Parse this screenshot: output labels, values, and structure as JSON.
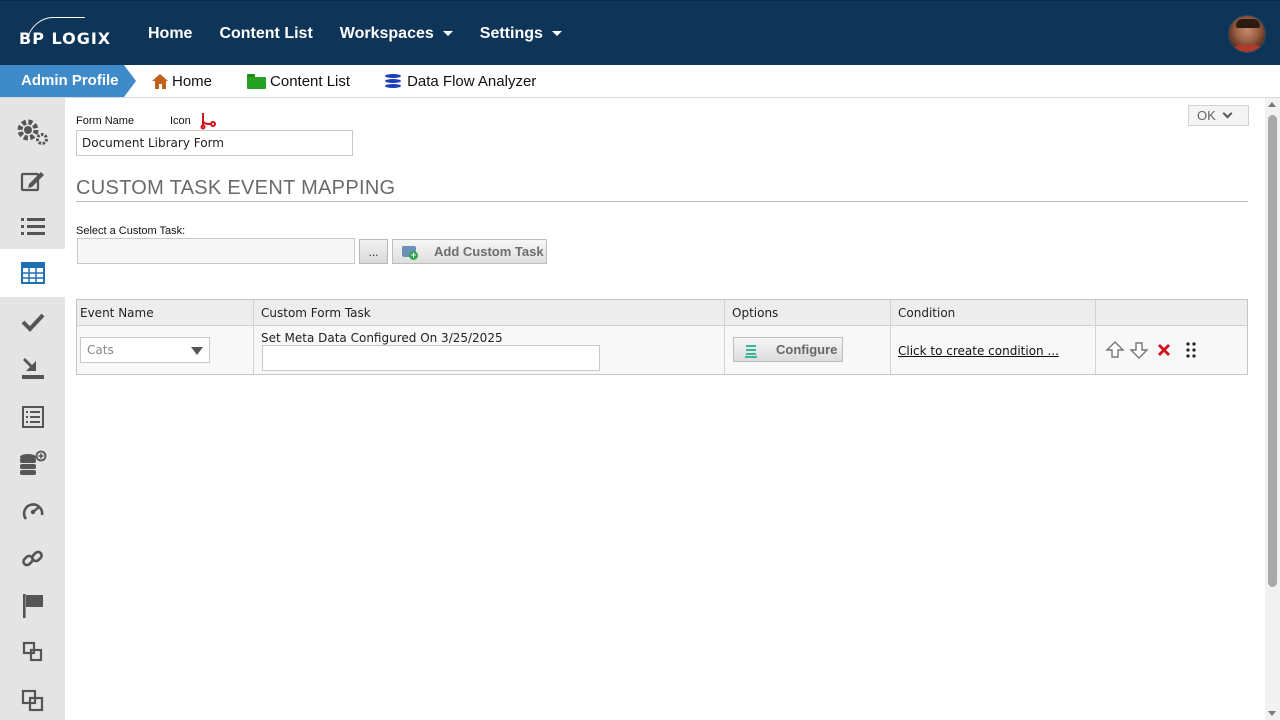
{
  "brand": {
    "logo_text": "BP LOGIX"
  },
  "topnav": {
    "items": [
      {
        "label": "Home",
        "has_caret": false
      },
      {
        "label": "Content List",
        "has_caret": false
      },
      {
        "label": "Workspaces",
        "has_caret": true
      },
      {
        "label": "Settings",
        "has_caret": true
      }
    ],
    "avatar_icon": "user-avatar"
  },
  "subbar": {
    "crumb": "Admin Profile",
    "items": [
      {
        "label": "Home",
        "icon": "home-icon",
        "color": "#c0601a"
      },
      {
        "label": "Content List",
        "icon": "folder-icon",
        "color": "#26a126"
      },
      {
        "label": "Data Flow Analyzer",
        "icon": "database-icon",
        "color": "#1b3fb8"
      }
    ]
  },
  "sidebar": {
    "items": [
      {
        "icon": "gears-icon"
      },
      {
        "icon": "edit-icon"
      },
      {
        "icon": "list-icon"
      },
      {
        "icon": "table-icon",
        "active": true
      },
      {
        "icon": "check-icon"
      },
      {
        "icon": "download-icon"
      },
      {
        "icon": "form-list-icon"
      },
      {
        "icon": "database-add-icon"
      },
      {
        "icon": "speedometer-icon"
      },
      {
        "icon": "link-icon"
      },
      {
        "icon": "flag-icon"
      },
      {
        "icon": "copy-icon"
      },
      {
        "icon": "clone-icon"
      }
    ]
  },
  "form": {
    "name_label": "Form Name",
    "icon_label": "Icon",
    "form_icon": "flow-icon",
    "name_value": "Document Library Form",
    "ok_label": "OK"
  },
  "mapping": {
    "heading": "CUSTOM TASK EVENT MAPPING",
    "select_label": "Select a Custom Task:",
    "select_value": "",
    "browse_label": "...",
    "add_label": "Add Custom Task"
  },
  "table": {
    "columns": [
      "Event Name",
      "Custom Form Task",
      "Options",
      "Condition",
      ""
    ],
    "rows": [
      {
        "event_name": "Cats",
        "task_title": "Set Meta Data Configured On 3/25/2025",
        "task_value": "",
        "option_label": "Configure",
        "condition_link": "Click to create condition ..."
      }
    ],
    "row_actions": [
      "move-up-icon",
      "move-down-icon",
      "delete-icon",
      "drag-handle-icon"
    ]
  },
  "colors": {
    "topbar": "#0e3558",
    "crumb": "#3f8ac9",
    "delete": "#d4141c",
    "sidebar": "#e4e4e4"
  }
}
